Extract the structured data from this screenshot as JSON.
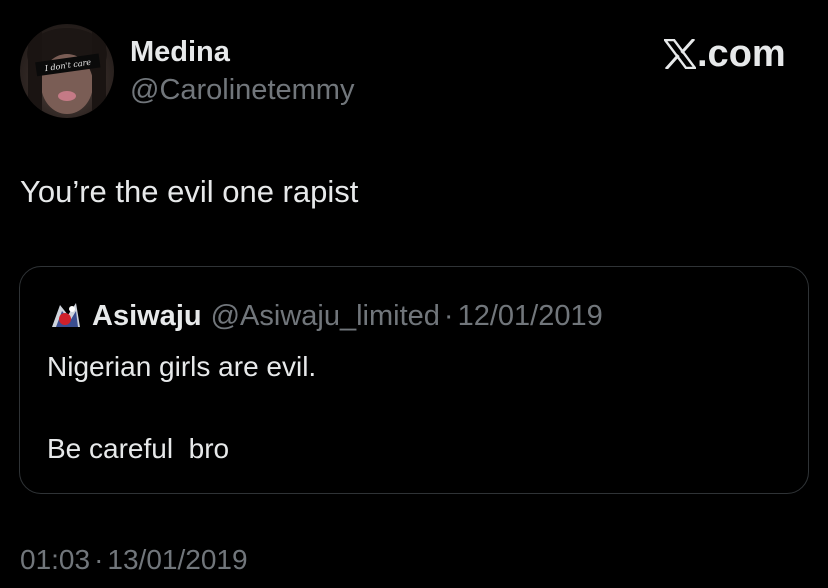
{
  "author": {
    "display_name": "Medina",
    "handle": "@Carolinetemmy",
    "avatar_caption": "I don't care"
  },
  "brand": {
    "icon": "x-logo-icon",
    "label": ".com"
  },
  "tweet": {
    "text": "You’re the evil one rapist",
    "time": "01:03",
    "separator": "·",
    "date": "13/01/2019"
  },
  "quoted_tweet": {
    "display_name": "Asiwaju",
    "handle": "@Asiwaju_limited",
    "separator": "·",
    "date": "12/01/2019",
    "lines": [
      "Nigerian girls are evil.",
      "Be careful  bro"
    ]
  },
  "colors": {
    "background": "#000000",
    "primary_text": "#e7e9ea",
    "secondary_text": "#71767b",
    "border": "#2f3336"
  }
}
